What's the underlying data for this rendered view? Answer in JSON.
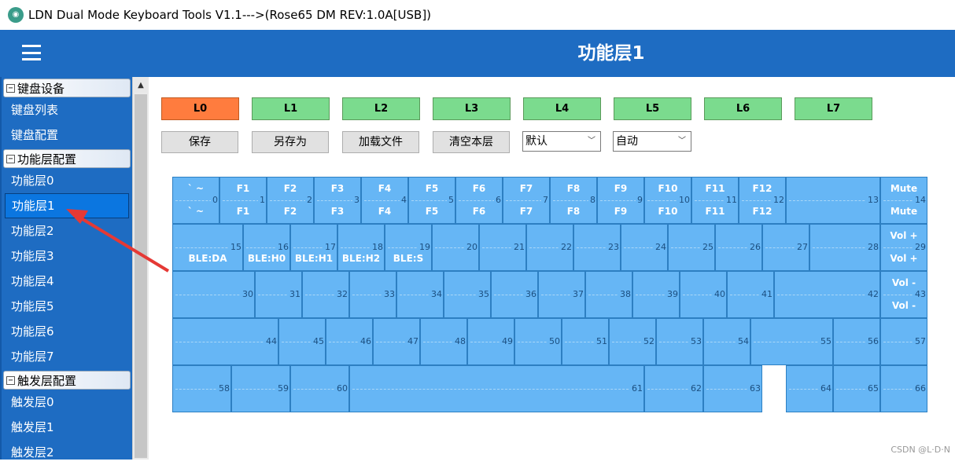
{
  "window": {
    "title": "LDN Dual Mode Keyboard Tools V1.1--->(Rose65 DM REV:1.0A[USB])"
  },
  "header": {
    "title": "功能层1"
  },
  "sidebar": {
    "groups": [
      {
        "label": "键盘设备",
        "items": [
          "键盘列表",
          "键盘配置"
        ]
      },
      {
        "label": "功能层配置",
        "items": [
          "功能层0",
          "功能层1",
          "功能层2",
          "功能层3",
          "功能层4",
          "功能层5",
          "功能层6",
          "功能层7"
        ]
      },
      {
        "label": "触发层配置",
        "items": [
          "触发层0",
          "触发层1",
          "触发层2"
        ]
      }
    ],
    "selected": "功能层1"
  },
  "layers": [
    "L0",
    "L1",
    "L2",
    "L3",
    "L4",
    "L5",
    "L6",
    "L7"
  ],
  "active_layer": "L0",
  "actions": {
    "save": "保存",
    "save_as": "另存为",
    "load_file": "加载文件",
    "clear_layer": "清空本层"
  },
  "selects": {
    "mode": "默认",
    "auto": "自动"
  },
  "keyboard": {
    "rows": [
      [
        {
          "n": "0",
          "t": "` ~",
          "b": "` ~",
          "w": 60
        },
        {
          "n": "1",
          "t": "F1",
          "b": "F1",
          "w": 60
        },
        {
          "n": "2",
          "t": "F2",
          "b": "F2",
          "w": 60
        },
        {
          "n": "3",
          "t": "F3",
          "b": "F3",
          "w": 60
        },
        {
          "n": "4",
          "t": "F4",
          "b": "F4",
          "w": 60
        },
        {
          "n": "5",
          "t": "F5",
          "b": "F5",
          "w": 60
        },
        {
          "n": "6",
          "t": "F6",
          "b": "F6",
          "w": 60
        },
        {
          "n": "7",
          "t": "F7",
          "b": "F7",
          "w": 60
        },
        {
          "n": "8",
          "t": "F8",
          "b": "F8",
          "w": 60
        },
        {
          "n": "9",
          "t": "F9",
          "b": "F9",
          "w": 60
        },
        {
          "n": "10",
          "t": "F10",
          "b": "F10",
          "w": 60
        },
        {
          "n": "11",
          "t": "F11",
          "b": "F11",
          "w": 60
        },
        {
          "n": "12",
          "t": "F12",
          "b": "F12",
          "w": 60
        },
        {
          "n": "13",
          "t": "",
          "b": "",
          "w": 120
        },
        {
          "n": "14",
          "t": "Mute",
          "b": "Mute",
          "w": 60
        }
      ],
      [
        {
          "n": "15",
          "t": "",
          "b": "BLE:DA",
          "w": 90
        },
        {
          "n": "16",
          "t": "",
          "b": "BLE:H0",
          "w": 60
        },
        {
          "n": "17",
          "t": "",
          "b": "BLE:H1",
          "w": 60
        },
        {
          "n": "18",
          "t": "",
          "b": "BLE:H2",
          "w": 60
        },
        {
          "n": "19",
          "t": "",
          "b": "BLE:S",
          "w": 60
        },
        {
          "n": "20",
          "t": "",
          "b": "",
          "w": 60
        },
        {
          "n": "21",
          "t": "",
          "b": "",
          "w": 60
        },
        {
          "n": "22",
          "t": "",
          "b": "",
          "w": 60
        },
        {
          "n": "23",
          "t": "",
          "b": "",
          "w": 60
        },
        {
          "n": "24",
          "t": "",
          "b": "",
          "w": 60
        },
        {
          "n": "25",
          "t": "",
          "b": "",
          "w": 60
        },
        {
          "n": "26",
          "t": "",
          "b": "",
          "w": 60
        },
        {
          "n": "27",
          "t": "",
          "b": "",
          "w": 60
        },
        {
          "n": "28",
          "t": "",
          "b": "",
          "w": 90
        },
        {
          "n": "29",
          "t": "Vol +",
          "b": "Vol +",
          "w": 60
        }
      ],
      [
        {
          "n": "30",
          "t": "",
          "b": "",
          "w": 105
        },
        {
          "n": "31",
          "t": "",
          "b": "",
          "w": 60
        },
        {
          "n": "32",
          "t": "",
          "b": "",
          "w": 60
        },
        {
          "n": "33",
          "t": "",
          "b": "",
          "w": 60
        },
        {
          "n": "34",
          "t": "",
          "b": "",
          "w": 60
        },
        {
          "n": "35",
          "t": "",
          "b": "",
          "w": 60
        },
        {
          "n": "36",
          "t": "",
          "b": "",
          "w": 60
        },
        {
          "n": "37",
          "t": "",
          "b": "",
          "w": 60
        },
        {
          "n": "38",
          "t": "",
          "b": "",
          "w": 60
        },
        {
          "n": "39",
          "t": "",
          "b": "",
          "w": 60
        },
        {
          "n": "40",
          "t": "",
          "b": "",
          "w": 60
        },
        {
          "n": "41",
          "t": "",
          "b": "",
          "w": 60
        },
        {
          "n": "42",
          "t": "",
          "b": "",
          "w": 135
        },
        {
          "n": "43",
          "t": "Vol -",
          "b": "Vol -",
          "w": 60
        }
      ],
      [
        {
          "n": "44",
          "t": "",
          "b": "",
          "w": 135
        },
        {
          "n": "45",
          "t": "",
          "b": "",
          "w": 60
        },
        {
          "n": "46",
          "t": "",
          "b": "",
          "w": 60
        },
        {
          "n": "47",
          "t": "",
          "b": "",
          "w": 60
        },
        {
          "n": "48",
          "t": "",
          "b": "",
          "w": 60
        },
        {
          "n": "49",
          "t": "",
          "b": "",
          "w": 60
        },
        {
          "n": "50",
          "t": "",
          "b": "",
          "w": 60
        },
        {
          "n": "51",
          "t": "",
          "b": "",
          "w": 60
        },
        {
          "n": "52",
          "t": "",
          "b": "",
          "w": 60
        },
        {
          "n": "53",
          "t": "",
          "b": "",
          "w": 60
        },
        {
          "n": "54",
          "t": "",
          "b": "",
          "w": 60
        },
        {
          "n": "55",
          "t": "",
          "b": "",
          "w": 105
        },
        {
          "n": "56",
          "t": "",
          "b": "",
          "w": 60
        },
        {
          "n": "57",
          "t": "",
          "b": "",
          "w": 60
        }
      ],
      [
        {
          "n": "58",
          "t": "",
          "b": "",
          "w": 75
        },
        {
          "n": "59",
          "t": "",
          "b": "",
          "w": 75
        },
        {
          "n": "60",
          "t": "",
          "b": "",
          "w": 75
        },
        {
          "n": "61",
          "t": "",
          "b": "",
          "w": 375
        },
        {
          "n": "62",
          "t": "",
          "b": "",
          "w": 75
        },
        {
          "n": "63",
          "t": "",
          "b": "",
          "w": 75
        },
        {
          "n": "gap",
          "t": "",
          "b": "",
          "w": 30
        },
        {
          "n": "64",
          "t": "",
          "b": "",
          "w": 60
        },
        {
          "n": "65",
          "t": "",
          "b": "",
          "w": 60
        },
        {
          "n": "66",
          "t": "",
          "b": "",
          "w": 60
        }
      ]
    ]
  },
  "watermark": "CSDN @L·D·N",
  "colors": {
    "header": "#1e6cc2",
    "active_layer": "#ff7c3e",
    "layer": "#7bdb8e",
    "key": "#66b6f5",
    "annotation_arrow": "#e53935"
  }
}
